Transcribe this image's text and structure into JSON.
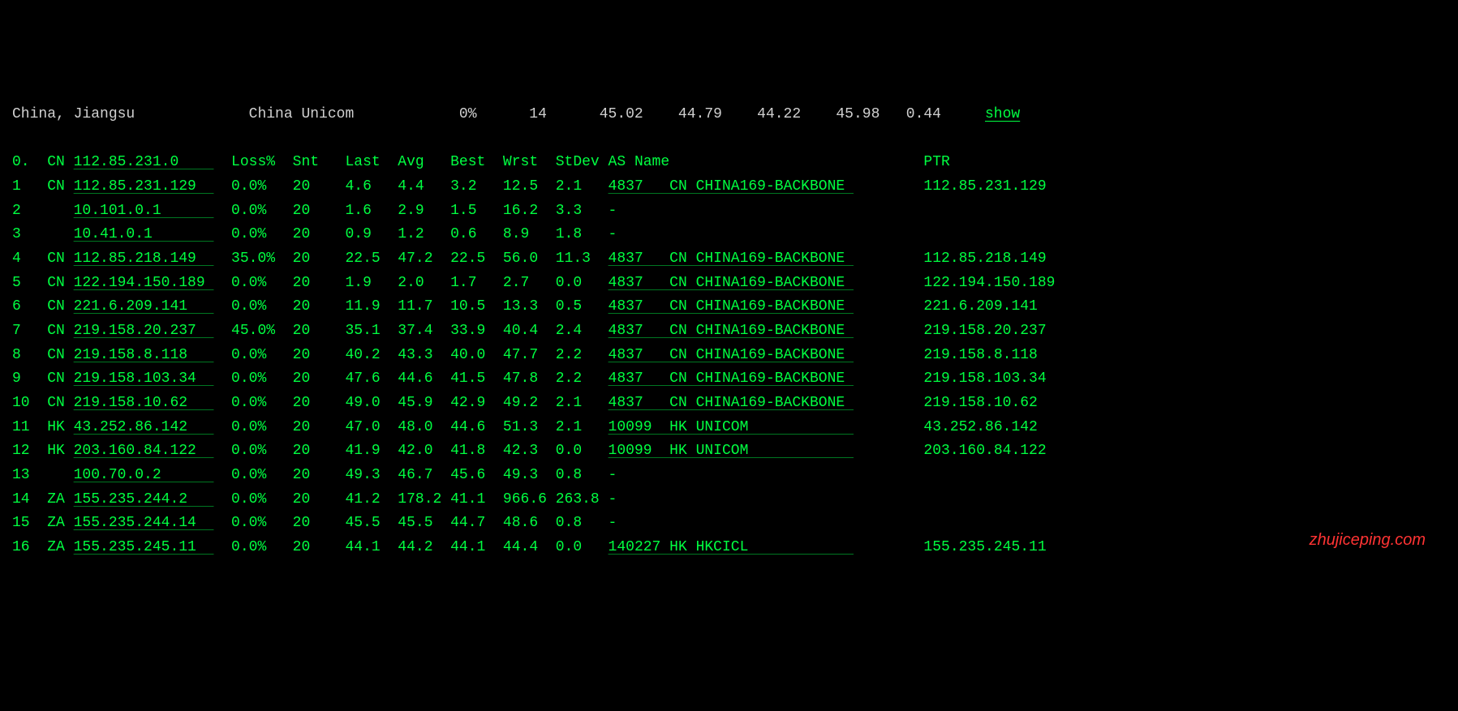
{
  "header": {
    "location": "China, Jiangsu",
    "provider": "China Unicom",
    "loss": "0%",
    "snt": "14",
    "last": "45.02",
    "avg": "44.79",
    "best": "44.22",
    "wrst": "45.98",
    "stdev": "0.44",
    "action": "show"
  },
  "columns": {
    "hop": "0.",
    "cc": "CN",
    "ip": "112.85.231.0",
    "loss": "Loss%",
    "snt": "Snt",
    "last": "Last",
    "avg": "Avg",
    "best": "Best",
    "wrst": "Wrst",
    "stdev": "StDev",
    "asname": "AS Name",
    "ptr": "PTR"
  },
  "rows": [
    {
      "hop": "1",
      "cc": "CN",
      "ip": "112.85.231.129",
      "loss": "0.0%",
      "snt": "20",
      "last": "4.6",
      "avg": "4.4",
      "best": "3.2",
      "wrst": "12.5",
      "stdev": "2.1",
      "asn": "4837",
      "ascc": "CN",
      "asname": "CHINA169-BACKBONE",
      "ptr": "112.85.231.129"
    },
    {
      "hop": "2",
      "cc": "",
      "ip": "10.101.0.1",
      "loss": "0.0%",
      "snt": "20",
      "last": "1.6",
      "avg": "2.9",
      "best": "1.5",
      "wrst": "16.2",
      "stdev": "3.3",
      "asn": "-",
      "ascc": "",
      "asname": "",
      "ptr": ""
    },
    {
      "hop": "3",
      "cc": "",
      "ip": "10.41.0.1",
      "loss": "0.0%",
      "snt": "20",
      "last": "0.9",
      "avg": "1.2",
      "best": "0.6",
      "wrst": "8.9",
      "stdev": "1.8",
      "asn": "-",
      "ascc": "",
      "asname": "",
      "ptr": ""
    },
    {
      "hop": "4",
      "cc": "CN",
      "ip": "112.85.218.149",
      "loss": "35.0%",
      "snt": "20",
      "last": "22.5",
      "avg": "47.2",
      "best": "22.5",
      "wrst": "56.0",
      "stdev": "11.3",
      "asn": "4837",
      "ascc": "CN",
      "asname": "CHINA169-BACKBONE",
      "ptr": "112.85.218.149"
    },
    {
      "hop": "5",
      "cc": "CN",
      "ip": "122.194.150.189",
      "loss": "0.0%",
      "snt": "20",
      "last": "1.9",
      "avg": "2.0",
      "best": "1.7",
      "wrst": "2.7",
      "stdev": "0.0",
      "asn": "4837",
      "ascc": "CN",
      "asname": "CHINA169-BACKBONE",
      "ptr": "122.194.150.189"
    },
    {
      "hop": "6",
      "cc": "CN",
      "ip": "221.6.209.141",
      "loss": "0.0%",
      "snt": "20",
      "last": "11.9",
      "avg": "11.7",
      "best": "10.5",
      "wrst": "13.3",
      "stdev": "0.5",
      "asn": "4837",
      "ascc": "CN",
      "asname": "CHINA169-BACKBONE",
      "ptr": "221.6.209.141"
    },
    {
      "hop": "7",
      "cc": "CN",
      "ip": "219.158.20.237",
      "loss": "45.0%",
      "snt": "20",
      "last": "35.1",
      "avg": "37.4",
      "best": "33.9",
      "wrst": "40.4",
      "stdev": "2.4",
      "asn": "4837",
      "ascc": "CN",
      "asname": "CHINA169-BACKBONE",
      "ptr": "219.158.20.237"
    },
    {
      "hop": "8",
      "cc": "CN",
      "ip": "219.158.8.118",
      "loss": "0.0%",
      "snt": "20",
      "last": "40.2",
      "avg": "43.3",
      "best": "40.0",
      "wrst": "47.7",
      "stdev": "2.2",
      "asn": "4837",
      "ascc": "CN",
      "asname": "CHINA169-BACKBONE",
      "ptr": "219.158.8.118"
    },
    {
      "hop": "9",
      "cc": "CN",
      "ip": "219.158.103.34",
      "loss": "0.0%",
      "snt": "20",
      "last": "47.6",
      "avg": "44.6",
      "best": "41.5",
      "wrst": "47.8",
      "stdev": "2.2",
      "asn": "4837",
      "ascc": "CN",
      "asname": "CHINA169-BACKBONE",
      "ptr": "219.158.103.34"
    },
    {
      "hop": "10",
      "cc": "CN",
      "ip": "219.158.10.62",
      "loss": "0.0%",
      "snt": "20",
      "last": "49.0",
      "avg": "45.9",
      "best": "42.9",
      "wrst": "49.2",
      "stdev": "2.1",
      "asn": "4837",
      "ascc": "CN",
      "asname": "CHINA169-BACKBONE",
      "ptr": "219.158.10.62"
    },
    {
      "hop": "11",
      "cc": "HK",
      "ip": "43.252.86.142",
      "loss": "0.0%",
      "snt": "20",
      "last": "47.0",
      "avg": "48.0",
      "best": "44.6",
      "wrst": "51.3",
      "stdev": "2.1",
      "asn": "10099",
      "ascc": "HK",
      "asname": "UNICOM",
      "ptr": "43.252.86.142"
    },
    {
      "hop": "12",
      "cc": "HK",
      "ip": "203.160.84.122",
      "loss": "0.0%",
      "snt": "20",
      "last": "41.9",
      "avg": "42.0",
      "best": "41.8",
      "wrst": "42.3",
      "stdev": "0.0",
      "asn": "10099",
      "ascc": "HK",
      "asname": "UNICOM",
      "ptr": "203.160.84.122"
    },
    {
      "hop": "13",
      "cc": "",
      "ip": "100.70.0.2",
      "loss": "0.0%",
      "snt": "20",
      "last": "49.3",
      "avg": "46.7",
      "best": "45.6",
      "wrst": "49.3",
      "stdev": "0.8",
      "asn": "-",
      "ascc": "",
      "asname": "",
      "ptr": ""
    },
    {
      "hop": "14",
      "cc": "ZA",
      "ip": "155.235.244.2",
      "loss": "0.0%",
      "snt": "20",
      "last": "41.2",
      "avg": "178.2",
      "best": "41.1",
      "wrst": "966.6",
      "stdev": "263.8",
      "asn": "-",
      "ascc": "",
      "asname": "",
      "ptr": ""
    },
    {
      "hop": "15",
      "cc": "ZA",
      "ip": "155.235.244.14",
      "loss": "0.0%",
      "snt": "20",
      "last": "45.5",
      "avg": "45.5",
      "best": "44.7",
      "wrst": "48.6",
      "stdev": "0.8",
      "asn": "-",
      "ascc": "",
      "asname": "",
      "ptr": ""
    },
    {
      "hop": "16",
      "cc": "ZA",
      "ip": "155.235.245.11",
      "loss": "0.0%",
      "snt": "20",
      "last": "44.1",
      "avg": "44.2",
      "best": "44.1",
      "wrst": "44.4",
      "stdev": "0.0",
      "asn": "140227",
      "ascc": "HK",
      "asname": "HKCICL",
      "ptr": "155.235.245.11"
    }
  ],
  "watermark": "zhujiceping.com"
}
